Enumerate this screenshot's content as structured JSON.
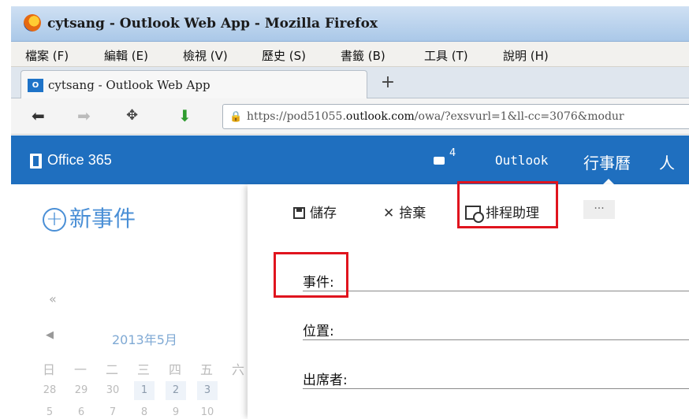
{
  "browser": {
    "window_title": "cytsang - Outlook Web App - Mozilla Firefox",
    "menu": [
      "檔案 (F)",
      "編輯 (E)",
      "檢視 (V)",
      "歷史 (S)",
      "書籤 (B)",
      "工具 (T)",
      "說明 (H)"
    ],
    "tab_title": "cytsang - Outlook Web App",
    "tab_icon_text": "O",
    "new_tab": "+",
    "url_prefix": "https://pod51055.",
    "url_domain": "outlook.com",
    "url_suffix": "/owa/?exsvurl=1&ll-cc=3076&modur"
  },
  "o365": {
    "brand": "Office 365",
    "notification_count": "4",
    "nav": {
      "outlook": "Outlook",
      "calendar": "行事曆",
      "people": "人"
    }
  },
  "sidebar": {
    "new_event": "新事件",
    "collapse": "«",
    "month": "2013年5月",
    "weekdays": [
      "日",
      "一",
      "二",
      "三",
      "四",
      "五",
      "六"
    ],
    "week1": [
      "28",
      "29",
      "30",
      "1",
      "2",
      "3"
    ],
    "week2": [
      "5",
      "6",
      "7",
      "8",
      "9",
      "10"
    ]
  },
  "toolbar": {
    "save": "儲存",
    "discard": "捨棄",
    "scheduling_assistant": "排程助理",
    "more": "···"
  },
  "form": {
    "subject_label": "事件:",
    "location_label": "位置:",
    "attendees_label": "出席者:"
  },
  "colors": {
    "o365_header": "#1f6fbf",
    "accent_link": "#4a8fd6",
    "highlight": "#e0141e"
  }
}
